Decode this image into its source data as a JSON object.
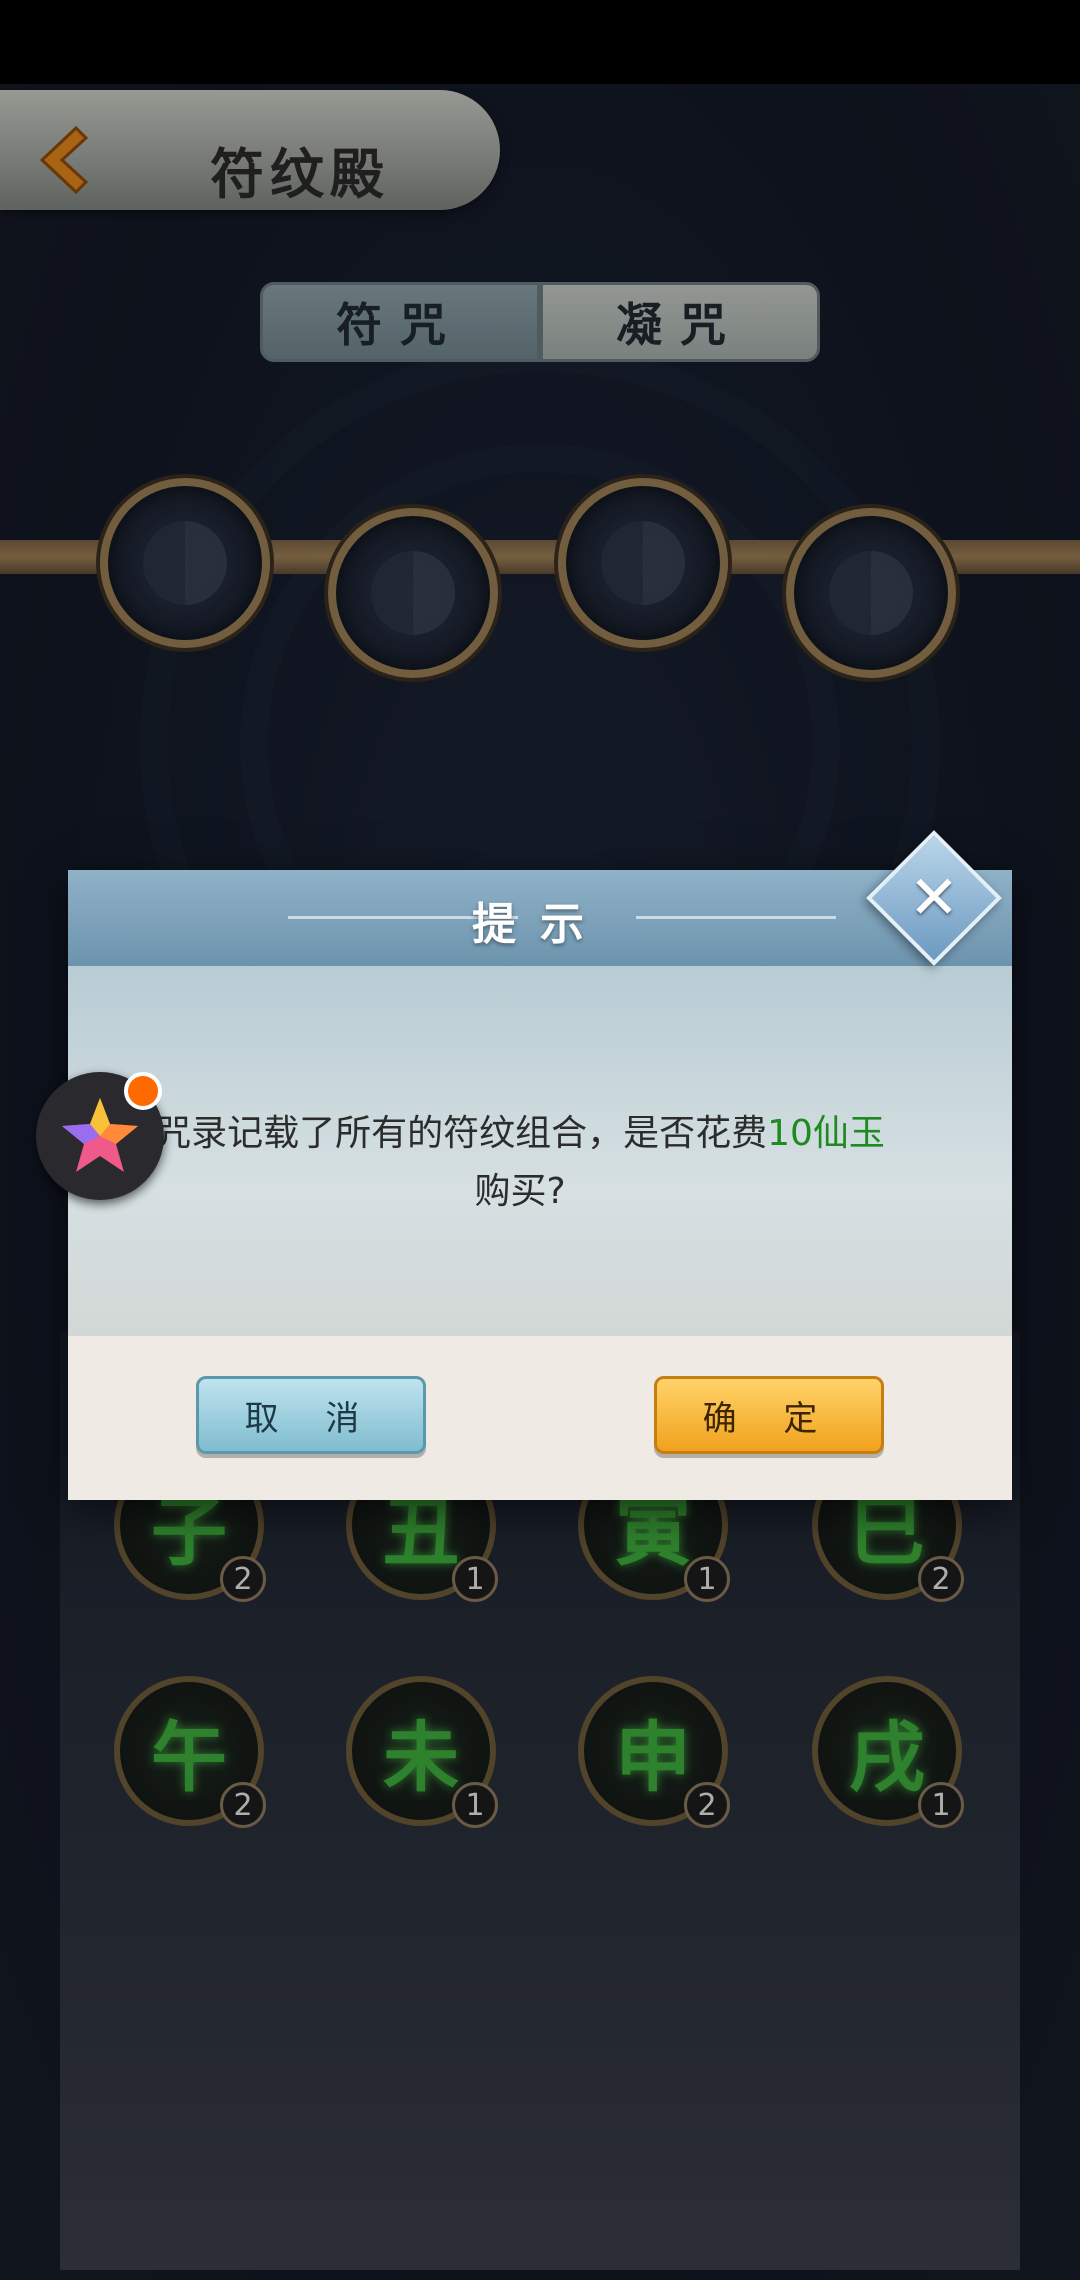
{
  "header": {
    "title": "符纹殿"
  },
  "tabs": [
    {
      "label": "符咒"
    },
    {
      "label": "凝咒"
    }
  ],
  "dialog": {
    "title": "提示",
    "message_prefix": "咒录记载了所有的符纹组合，是否花费",
    "highlight": "10仙玉",
    "message_suffix": "购买?",
    "cancel_label": "取 消",
    "confirm_label": "确 定"
  },
  "runes_row1": [
    {
      "glyph": "子",
      "count": "2"
    },
    {
      "glyph": "丑",
      "count": "1"
    },
    {
      "glyph": "寅",
      "count": "1"
    },
    {
      "glyph": "巳",
      "count": "2"
    }
  ],
  "runes_row2": [
    {
      "glyph": "午",
      "count": "2"
    },
    {
      "glyph": "未",
      "count": "1"
    },
    {
      "glyph": "申",
      "count": "2"
    },
    {
      "glyph": "戌",
      "count": "1"
    }
  ],
  "colors": {
    "highlight": "#1f8a1f",
    "confirm": "#f1a21d",
    "cancel": "#7fbdd0"
  }
}
